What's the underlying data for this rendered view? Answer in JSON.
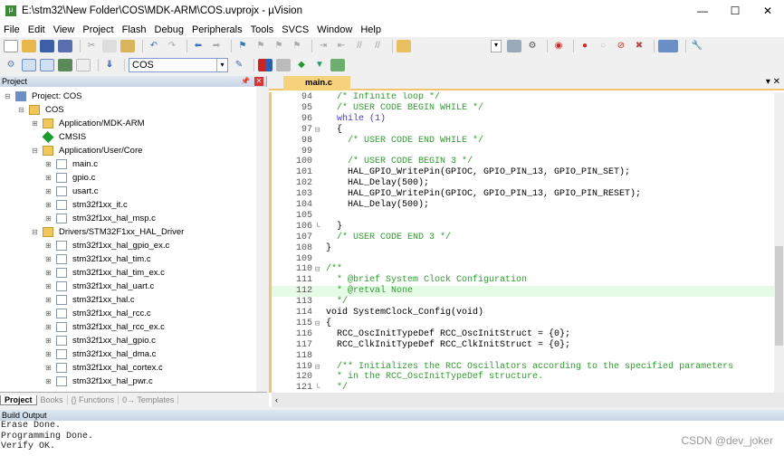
{
  "window": {
    "title": "E:\\stm32\\New Folder\\COS\\MDK-ARM\\COS.uvprojx - µVision",
    "min": "—",
    "max": "☐",
    "close": "✕"
  },
  "menu": [
    "File",
    "Edit",
    "View",
    "Project",
    "Flash",
    "Debug",
    "Peripherals",
    "Tools",
    "SVCS",
    "Window",
    "Help"
  ],
  "toolbar2": {
    "target": "COS"
  },
  "project_panel": {
    "title": "Project",
    "tree": [
      {
        "label": "Project: COS",
        "indent": 0,
        "icon": "project",
        "exp": "⊟"
      },
      {
        "label": "COS",
        "indent": 1,
        "icon": "folder",
        "exp": "⊟"
      },
      {
        "label": "Application/MDK-ARM",
        "indent": 2,
        "icon": "folder",
        "exp": "⊞"
      },
      {
        "label": "CMSIS",
        "indent": 2,
        "icon": "gem",
        "exp": ""
      },
      {
        "label": "Application/User/Core",
        "indent": 2,
        "icon": "folder",
        "exp": "⊟"
      },
      {
        "label": "main.c",
        "indent": 3,
        "icon": "file",
        "exp": "⊞"
      },
      {
        "label": "gpio.c",
        "indent": 3,
        "icon": "file",
        "exp": "⊞"
      },
      {
        "label": "usart.c",
        "indent": 3,
        "icon": "file",
        "exp": "⊞"
      },
      {
        "label": "stm32f1xx_it.c",
        "indent": 3,
        "icon": "file",
        "exp": "⊞"
      },
      {
        "label": "stm32f1xx_hal_msp.c",
        "indent": 3,
        "icon": "file",
        "exp": "⊞"
      },
      {
        "label": "Drivers/STM32F1xx_HAL_Driver",
        "indent": 2,
        "icon": "folder",
        "exp": "⊟"
      },
      {
        "label": "stm32f1xx_hal_gpio_ex.c",
        "indent": 3,
        "icon": "file",
        "exp": "⊞"
      },
      {
        "label": "stm32f1xx_hal_tim.c",
        "indent": 3,
        "icon": "file",
        "exp": "⊞"
      },
      {
        "label": "stm32f1xx_hal_tim_ex.c",
        "indent": 3,
        "icon": "file",
        "exp": "⊞"
      },
      {
        "label": "stm32f1xx_hal_uart.c",
        "indent": 3,
        "icon": "file",
        "exp": "⊞"
      },
      {
        "label": "stm32f1xx_hal.c",
        "indent": 3,
        "icon": "file",
        "exp": "⊞"
      },
      {
        "label": "stm32f1xx_hal_rcc.c",
        "indent": 3,
        "icon": "file",
        "exp": "⊞"
      },
      {
        "label": "stm32f1xx_hal_rcc_ex.c",
        "indent": 3,
        "icon": "file",
        "exp": "⊞"
      },
      {
        "label": "stm32f1xx_hal_gpio.c",
        "indent": 3,
        "icon": "file",
        "exp": "⊞"
      },
      {
        "label": "stm32f1xx_hal_dma.c",
        "indent": 3,
        "icon": "file",
        "exp": "⊞"
      },
      {
        "label": "stm32f1xx_hal_cortex.c",
        "indent": 3,
        "icon": "file",
        "exp": "⊞"
      },
      {
        "label": "stm32f1xx_hal_pwr.c",
        "indent": 3,
        "icon": "file",
        "exp": "⊞"
      }
    ],
    "tabs": [
      "Project",
      "Books",
      "{} Functions",
      "0→ Templates"
    ]
  },
  "editor": {
    "tab": "main.c",
    "lines": [
      {
        "n": "94",
        "fold": "",
        "t": "  /* Infinite loop */",
        "cls": "c"
      },
      {
        "n": "95",
        "fold": "",
        "t": "  /* USER CODE BEGIN WHILE */",
        "cls": "c"
      },
      {
        "n": "96",
        "fold": "",
        "t": "  while (1)",
        "cls": "k"
      },
      {
        "n": "97",
        "fold": "⊟",
        "t": "  {",
        "cls": ""
      },
      {
        "n": "98",
        "fold": "",
        "t": "    /* USER CODE END WHILE */",
        "cls": "c"
      },
      {
        "n": "99",
        "fold": "",
        "t": "",
        "cls": ""
      },
      {
        "n": "100",
        "fold": "",
        "t": "    /* USER CODE BEGIN 3 */",
        "cls": "c"
      },
      {
        "n": "101",
        "fold": "",
        "t": "    HAL_GPIO_WritePin(GPIOC, GPIO_PIN_13, GPIO_PIN_SET);",
        "cls": ""
      },
      {
        "n": "102",
        "fold": "",
        "t": "    HAL_Delay(500);",
        "cls": ""
      },
      {
        "n": "103",
        "fold": "",
        "t": "    HAL_GPIO_WritePin(GPIOC, GPIO_PIN_13, GPIO_PIN_RESET);",
        "cls": ""
      },
      {
        "n": "104",
        "fold": "",
        "t": "    HAL_Delay(500);",
        "cls": ""
      },
      {
        "n": "105",
        "fold": "",
        "t": "",
        "cls": ""
      },
      {
        "n": "106",
        "fold": "└",
        "t": "  }",
        "cls": ""
      },
      {
        "n": "107",
        "fold": "",
        "t": "  /* USER CODE END 3 */",
        "cls": "c"
      },
      {
        "n": "108",
        "fold": "",
        "t": "}",
        "cls": ""
      },
      {
        "n": "109",
        "fold": "",
        "t": "",
        "cls": ""
      },
      {
        "n": "110",
        "fold": "⊟",
        "t": "/**",
        "cls": "c"
      },
      {
        "n": "111",
        "fold": "",
        "t": "  * @brief System Clock Configuration",
        "cls": "c"
      },
      {
        "n": "112",
        "fold": "",
        "t": "  * @retval None",
        "cls": "c",
        "hl": true
      },
      {
        "n": "113",
        "fold": "",
        "t": "  */",
        "cls": "c"
      },
      {
        "n": "114",
        "fold": "",
        "t": "void SystemClock_Config(void)",
        "cls": ""
      },
      {
        "n": "115",
        "fold": "⊟",
        "t": "{",
        "cls": ""
      },
      {
        "n": "116",
        "fold": "",
        "t": "  RCC_OscInitTypeDef RCC_OscInitStruct = {0};",
        "cls": ""
      },
      {
        "n": "117",
        "fold": "",
        "t": "  RCC_ClkInitTypeDef RCC_ClkInitStruct = {0};",
        "cls": ""
      },
      {
        "n": "118",
        "fold": "",
        "t": "",
        "cls": ""
      },
      {
        "n": "119",
        "fold": "⊟",
        "t": "  /** Initializes the RCC Oscillators according to the specified parameters",
        "cls": "c"
      },
      {
        "n": "120",
        "fold": "",
        "t": "  * in the RCC_OscInitTypeDef structure.",
        "cls": "c"
      },
      {
        "n": "121",
        "fold": "└",
        "t": "  */",
        "cls": "c"
      }
    ]
  },
  "build_output": {
    "title": "Build Output",
    "lines": [
      "Erase Done.",
      "Programming Done.",
      "Verify OK."
    ]
  },
  "watermark": "CSDN @dev_joker"
}
